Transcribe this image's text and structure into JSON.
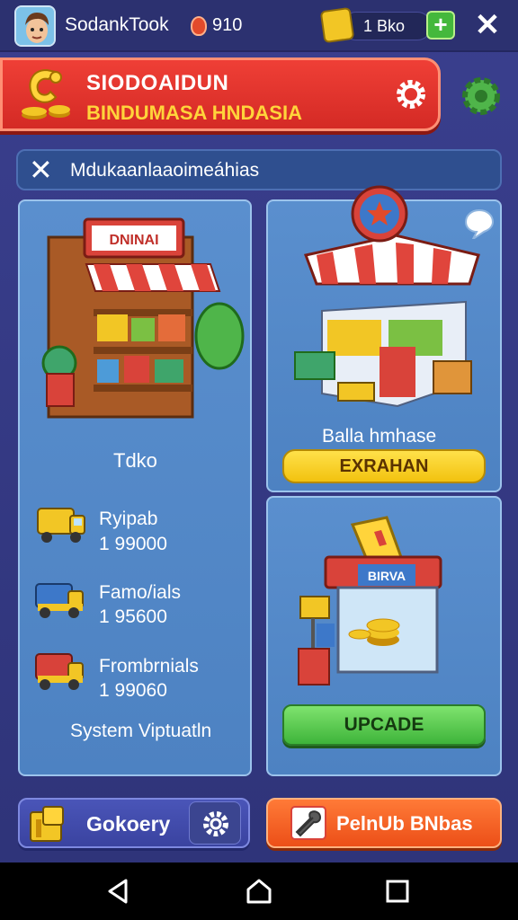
{
  "topbar": {
    "player_name": "SodankTook",
    "gem_count": "910",
    "cash_value": "1 Bko",
    "plus_label": "+",
    "close_label": "✕"
  },
  "banner": {
    "title": "SIODOAIDUN",
    "subtitle": "BINDUMASA HNDASIA"
  },
  "search": {
    "icon_label": "✕",
    "text": "Mdukaanlaaoimeáhias"
  },
  "left_panel": {
    "shop_sign": "DNINAI",
    "title": "Tdko",
    "vehicles": [
      {
        "name": "Ryipab",
        "price": "1 99000",
        "color": "#f2c625"
      },
      {
        "name": "Famo/ials",
        "price": "1 95600",
        "color": "#3d78c9"
      },
      {
        "name": "Frombrnials",
        "price": "1 99060",
        "color": "#d8423a"
      }
    ],
    "footer": "System Viptuatln"
  },
  "right_top_panel": {
    "caption": "Balla hmhase",
    "button_label": "EXRAHAN"
  },
  "right_bottom_panel": {
    "kiosk_sign": "BIRVA",
    "button_label": "UPCADE"
  },
  "bottom_bar": {
    "left_label": "Gokoery",
    "right_label": "PelnUb BNbas"
  },
  "colors": {
    "background": "#3a3f8e",
    "banner_red": "#ef3f36",
    "banner_accent": "#ffd43b",
    "panel_blue": "#5a8fce",
    "upgrade_green": "#3eb43a",
    "exrahan_yellow": "#f2c20f",
    "orange_button": "#ec4f18"
  },
  "icons": [
    "avatar",
    "gem-icon",
    "cash-icon",
    "plus-icon",
    "close-icon",
    "coin-logo",
    "gear-icon",
    "search-x-icon",
    "speech-bubble-icon",
    "truck-icon",
    "box-icon",
    "wrench-icon",
    "back-icon",
    "home-icon",
    "recents-icon"
  ]
}
